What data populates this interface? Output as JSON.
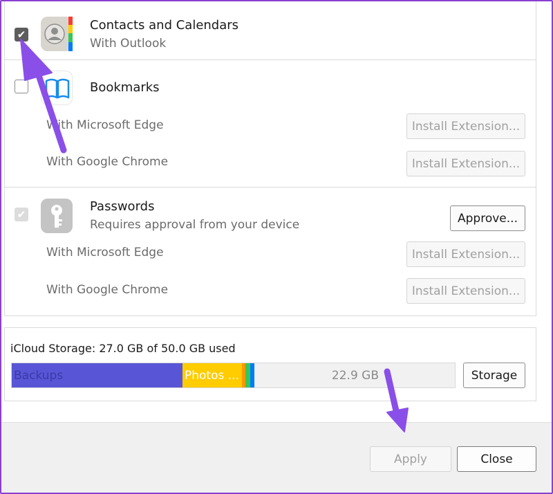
{
  "services": {
    "contacts": {
      "title": "Contacts and Calendars",
      "subtitle": "With Outlook",
      "checked": true,
      "icon": "contacts-icon"
    },
    "bookmarks": {
      "title": "Bookmarks",
      "checked": false,
      "icon": "book-icon",
      "browsers": [
        {
          "label": "With Microsoft Edge",
          "button": "Install Extension..."
        },
        {
          "label": "With Google Chrome",
          "button": "Install Extension..."
        }
      ]
    },
    "passwords": {
      "title": "Passwords",
      "subtitle": "Requires approval from your device",
      "checked": true,
      "icon": "key-icon",
      "approve_label": "Approve...",
      "browsers": [
        {
          "label": "With Microsoft Edge",
          "button": "Install Extension..."
        },
        {
          "label": "With Google Chrome",
          "button": "Install Extension..."
        }
      ]
    }
  },
  "storage": {
    "label": "iCloud Storage: 27.0 GB of 50.0 GB used",
    "free_label": "22.9 GB",
    "button": "Storage",
    "segments": [
      {
        "name": "Backups",
        "color": "#5856d6",
        "fraction": 0.386
      },
      {
        "name": "Photos ...",
        "color": "#ffcc00",
        "fraction": 0.134
      },
      {
        "name": "",
        "color": "#ff9500",
        "fraction": 0.008
      },
      {
        "name": "",
        "color": "#34c759",
        "fraction": 0.011
      },
      {
        "name": "",
        "color": "#007aff",
        "fraction": 0.01
      }
    ]
  },
  "footer": {
    "apply_label": "Apply",
    "close_label": "Close"
  },
  "colors": {
    "annotation_arrow": "#8a4fe8",
    "frame_border": "#8a3fd1"
  }
}
